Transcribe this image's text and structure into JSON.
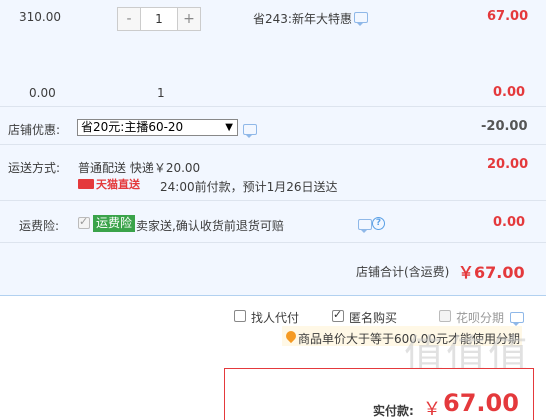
{
  "item": {
    "unit_price": "310.00",
    "quantity": "1",
    "minus_label": "-",
    "plus_label": "+",
    "promo_text": "省243:新年大特惠",
    "subtotal": "67.00"
  },
  "summary_row": {
    "left_value": "0.00",
    "quantity": "1",
    "right_value": "0.00"
  },
  "shop_discount": {
    "label": "店铺优惠:",
    "selected_option": "省20元:主播60-20",
    "amount": "-20.00"
  },
  "shipping": {
    "label": "运送方式:",
    "method": "普通配送 快递￥20.00",
    "badge_text": "天猫直送",
    "delivery_note": "24:00前付款，预计1月26日送达",
    "amount": "20.00"
  },
  "insurance": {
    "label": "运费险:",
    "tag": "运费险",
    "description": "卖家送,确认收货前退货可赔",
    "amount": "0.00"
  },
  "shop_total": {
    "label": "店铺合计(含运费)",
    "amount": "￥67.00"
  },
  "options": {
    "find_payer": "找人代付",
    "anonymous": "匿名购买",
    "huabei": "花呗分期",
    "huabei_tip": "商品单价大于等于600.00元才能使用分期"
  },
  "payment": {
    "label": "实付款:",
    "currency": "￥",
    "amount": "67.00"
  },
  "watermark": {
    "text": "值值值"
  },
  "colors": {
    "price_red": "#e4393c",
    "panel_blue": "#f2f7ff",
    "tag_green": "#3aa34a"
  }
}
